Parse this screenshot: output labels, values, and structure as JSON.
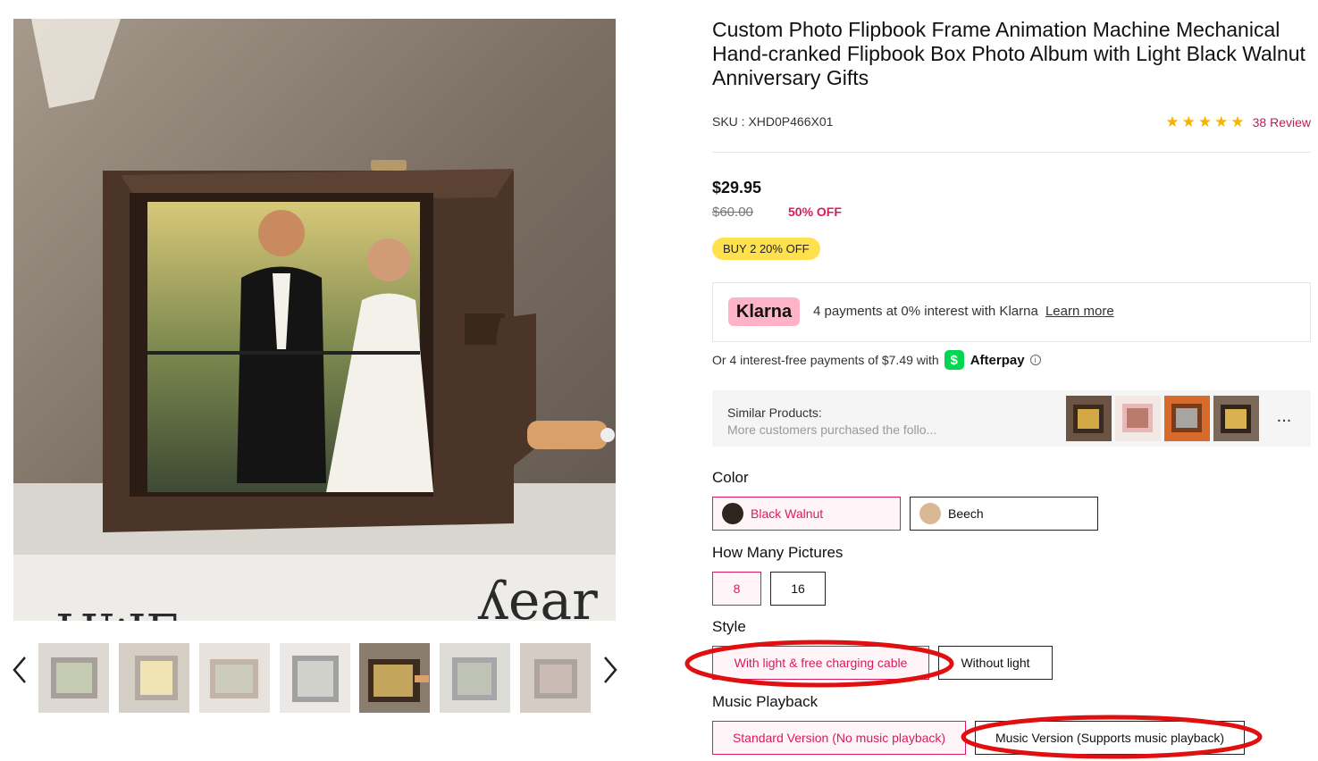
{
  "product": {
    "title": "Custom Photo Flipbook Frame Animation Machine Mechanical Hand-cranked Flipbook Box Photo Album with Light Black Walnut Anniversary Gifts",
    "sku_label": "SKU : XHD0P466X01",
    "rating_stars": 5,
    "review_link": "38 Review",
    "price": "$29.95",
    "original_price": "$60.00",
    "discount": "50% OFF",
    "promo_badge": "BUY 2 20% OFF"
  },
  "klarna": {
    "logo": "Klarna",
    "text": "4 payments at 0% interest with Klarna",
    "learn_more": "Learn more"
  },
  "afterpay": {
    "text": "Or 4 interest-free payments of $7.49 with",
    "cash_icon": "$",
    "brand": "Afterpay",
    "info_icon": "i"
  },
  "similar": {
    "title": "Similar Products:",
    "subtitle": "More customers purchased the follo...",
    "more": "..."
  },
  "options": {
    "color_label": "Color",
    "colors": [
      {
        "label": "Black Walnut",
        "swatch": "#2e2520",
        "selected": true
      },
      {
        "label": "Beech",
        "swatch": "#d9b894",
        "selected": false
      }
    ],
    "pictures_label": "How Many Pictures",
    "pictures": [
      {
        "label": "8",
        "selected": true
      },
      {
        "label": "16",
        "selected": false
      }
    ],
    "style_label": "Style",
    "styles": [
      {
        "label": "With light & free charging cable",
        "selected": true
      },
      {
        "label": "Without light",
        "selected": false
      }
    ],
    "music_label": "Music Playback",
    "music": [
      {
        "label": "Standard Version (No music playback)",
        "selected": true
      },
      {
        "label": "Music Version (Supports music playback)",
        "selected": false
      }
    ]
  },
  "gallery": {
    "main_image": "flipbook-box-with-couple-photo",
    "thumbnail_count": 7,
    "active_thumbnail": 5
  },
  "colors": {
    "accent": "#d81b60",
    "promo": "#ffe14d",
    "klarna_pink": "#ffb3c7",
    "cashapp_green": "#00d64f",
    "annotation_red": "#e01010"
  }
}
